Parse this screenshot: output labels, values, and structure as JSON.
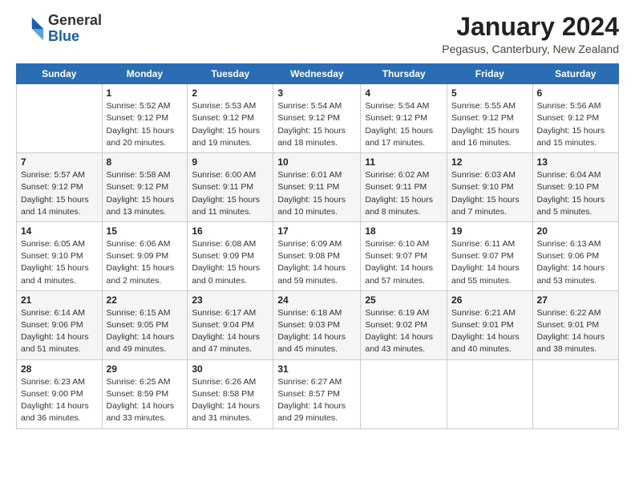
{
  "logo": {
    "general": "General",
    "blue": "Blue"
  },
  "header": {
    "month": "January 2024",
    "location": "Pegasus, Canterbury, New Zealand"
  },
  "weekdays": [
    "Sunday",
    "Monday",
    "Tuesday",
    "Wednesday",
    "Thursday",
    "Friday",
    "Saturday"
  ],
  "weeks": [
    [
      {
        "day": "",
        "info": ""
      },
      {
        "day": "1",
        "info": "Sunrise: 5:52 AM\nSunset: 9:12 PM\nDaylight: 15 hours\nand 20 minutes."
      },
      {
        "day": "2",
        "info": "Sunrise: 5:53 AM\nSunset: 9:12 PM\nDaylight: 15 hours\nand 19 minutes."
      },
      {
        "day": "3",
        "info": "Sunrise: 5:54 AM\nSunset: 9:12 PM\nDaylight: 15 hours\nand 18 minutes."
      },
      {
        "day": "4",
        "info": "Sunrise: 5:54 AM\nSunset: 9:12 PM\nDaylight: 15 hours\nand 17 minutes."
      },
      {
        "day": "5",
        "info": "Sunrise: 5:55 AM\nSunset: 9:12 PM\nDaylight: 15 hours\nand 16 minutes."
      },
      {
        "day": "6",
        "info": "Sunrise: 5:56 AM\nSunset: 9:12 PM\nDaylight: 15 hours\nand 15 minutes."
      }
    ],
    [
      {
        "day": "7",
        "info": "Sunrise: 5:57 AM\nSunset: 9:12 PM\nDaylight: 15 hours\nand 14 minutes."
      },
      {
        "day": "8",
        "info": "Sunrise: 5:58 AM\nSunset: 9:12 PM\nDaylight: 15 hours\nand 13 minutes."
      },
      {
        "day": "9",
        "info": "Sunrise: 6:00 AM\nSunset: 9:11 PM\nDaylight: 15 hours\nand 11 minutes."
      },
      {
        "day": "10",
        "info": "Sunrise: 6:01 AM\nSunset: 9:11 PM\nDaylight: 15 hours\nand 10 minutes."
      },
      {
        "day": "11",
        "info": "Sunrise: 6:02 AM\nSunset: 9:11 PM\nDaylight: 15 hours\nand 8 minutes."
      },
      {
        "day": "12",
        "info": "Sunrise: 6:03 AM\nSunset: 9:10 PM\nDaylight: 15 hours\nand 7 minutes."
      },
      {
        "day": "13",
        "info": "Sunrise: 6:04 AM\nSunset: 9:10 PM\nDaylight: 15 hours\nand 5 minutes."
      }
    ],
    [
      {
        "day": "14",
        "info": "Sunrise: 6:05 AM\nSunset: 9:10 PM\nDaylight: 15 hours\nand 4 minutes."
      },
      {
        "day": "15",
        "info": "Sunrise: 6:06 AM\nSunset: 9:09 PM\nDaylight: 15 hours\nand 2 minutes."
      },
      {
        "day": "16",
        "info": "Sunrise: 6:08 AM\nSunset: 9:09 PM\nDaylight: 15 hours\nand 0 minutes."
      },
      {
        "day": "17",
        "info": "Sunrise: 6:09 AM\nSunset: 9:08 PM\nDaylight: 14 hours\nand 59 minutes."
      },
      {
        "day": "18",
        "info": "Sunrise: 6:10 AM\nSunset: 9:07 PM\nDaylight: 14 hours\nand 57 minutes."
      },
      {
        "day": "19",
        "info": "Sunrise: 6:11 AM\nSunset: 9:07 PM\nDaylight: 14 hours\nand 55 minutes."
      },
      {
        "day": "20",
        "info": "Sunrise: 6:13 AM\nSunset: 9:06 PM\nDaylight: 14 hours\nand 53 minutes."
      }
    ],
    [
      {
        "day": "21",
        "info": "Sunrise: 6:14 AM\nSunset: 9:06 PM\nDaylight: 14 hours\nand 51 minutes."
      },
      {
        "day": "22",
        "info": "Sunrise: 6:15 AM\nSunset: 9:05 PM\nDaylight: 14 hours\nand 49 minutes."
      },
      {
        "day": "23",
        "info": "Sunrise: 6:17 AM\nSunset: 9:04 PM\nDaylight: 14 hours\nand 47 minutes."
      },
      {
        "day": "24",
        "info": "Sunrise: 6:18 AM\nSunset: 9:03 PM\nDaylight: 14 hours\nand 45 minutes."
      },
      {
        "day": "25",
        "info": "Sunrise: 6:19 AM\nSunset: 9:02 PM\nDaylight: 14 hours\nand 43 minutes."
      },
      {
        "day": "26",
        "info": "Sunrise: 6:21 AM\nSunset: 9:01 PM\nDaylight: 14 hours\nand 40 minutes."
      },
      {
        "day": "27",
        "info": "Sunrise: 6:22 AM\nSunset: 9:01 PM\nDaylight: 14 hours\nand 38 minutes."
      }
    ],
    [
      {
        "day": "28",
        "info": "Sunrise: 6:23 AM\nSunset: 9:00 PM\nDaylight: 14 hours\nand 36 minutes."
      },
      {
        "day": "29",
        "info": "Sunrise: 6:25 AM\nSunset: 8:59 PM\nDaylight: 14 hours\nand 33 minutes."
      },
      {
        "day": "30",
        "info": "Sunrise: 6:26 AM\nSunset: 8:58 PM\nDaylight: 14 hours\nand 31 minutes."
      },
      {
        "day": "31",
        "info": "Sunrise: 6:27 AM\nSunset: 8:57 PM\nDaylight: 14 hours\nand 29 minutes."
      },
      {
        "day": "",
        "info": ""
      },
      {
        "day": "",
        "info": ""
      },
      {
        "day": "",
        "info": ""
      }
    ]
  ]
}
